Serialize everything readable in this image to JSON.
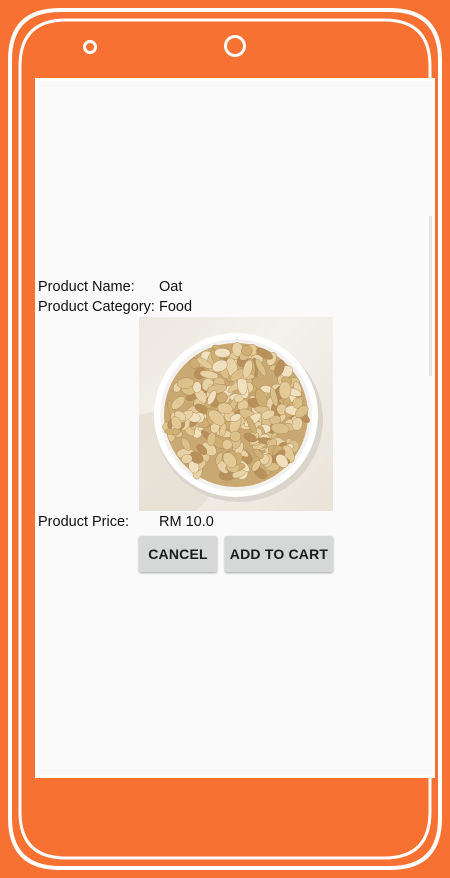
{
  "product": {
    "name_label": "Product Name:",
    "name_value": "Oat",
    "category_label": "Product Category:",
    "category_value": "Food",
    "image_icon": "oats-bowl-image",
    "price_label": "Product Price:",
    "price_value": "RM 10.0"
  },
  "actions": {
    "cancel_label": "CANCEL",
    "add_to_cart_label": "ADD TO CART"
  },
  "colors": {
    "frame": "#f77232",
    "screen_background": "#fafafa",
    "button_background": "#d6d7d7"
  }
}
